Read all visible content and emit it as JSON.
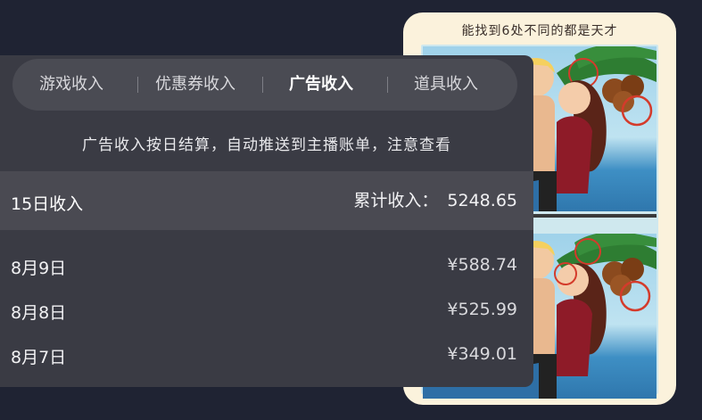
{
  "game": {
    "title": "能找到6处不同的都是天才"
  },
  "tabs": [
    {
      "label": "游戏收入",
      "active": false
    },
    {
      "label": "优惠券收入",
      "active": false
    },
    {
      "label": "广告收入",
      "active": true
    },
    {
      "label": "道具收入",
      "active": false
    }
  ],
  "notice": "广告收入按日结算，自动推送到主播账单，注意查看",
  "summary": {
    "period_label": "15日收入",
    "total_label": "累计收入：",
    "total_value": "5248.65"
  },
  "rows": [
    {
      "date": "8月9日",
      "amount": "¥588.74"
    },
    {
      "date": "8月8日",
      "amount": "¥525.99"
    },
    {
      "date": "8月7日",
      "amount": "¥349.01"
    }
  ],
  "colors": {
    "background": "#1f2333",
    "panel": "#3a3b44",
    "tab_bar": "#4a4b53",
    "card": "#fbf2dc"
  }
}
